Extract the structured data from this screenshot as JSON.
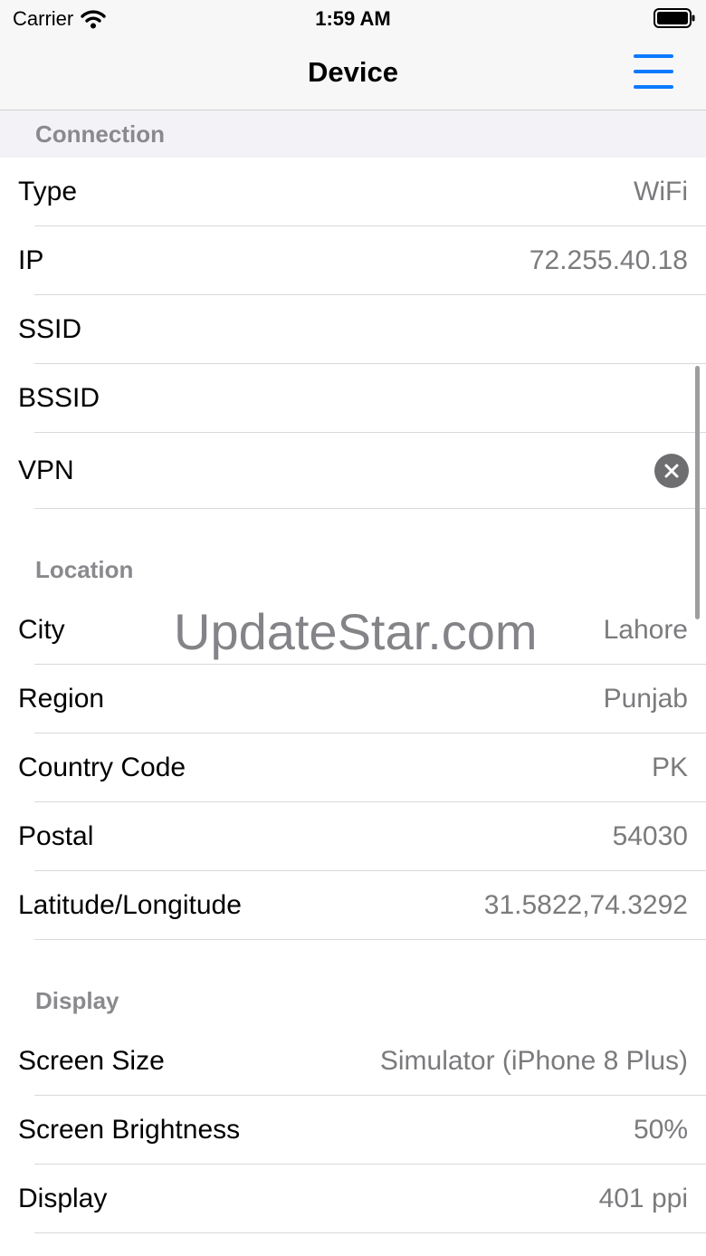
{
  "status_bar": {
    "carrier": "Carrier",
    "time": "1:59 AM",
    "wifi_icon": "wifi-icon",
    "battery_icon": "battery-icon"
  },
  "nav": {
    "title": "Device",
    "menu_icon": "hamburger-menu-icon",
    "accent_color": "#0A7AFF"
  },
  "sections": {
    "connection": {
      "header": "Connection",
      "rows": [
        {
          "label": "Type",
          "value": "WiFi"
        },
        {
          "label": "IP",
          "value": "72.255.40.18"
        },
        {
          "label": "SSID",
          "value": ""
        },
        {
          "label": "BSSID",
          "value": ""
        },
        {
          "label": "VPN",
          "icon": "close-circle-icon"
        }
      ]
    },
    "location": {
      "header": "Location",
      "rows": [
        {
          "label": "City",
          "value": "Lahore"
        },
        {
          "label": "Region",
          "value": "Punjab"
        },
        {
          "label": "Country Code",
          "value": "PK"
        },
        {
          "label": "Postal",
          "value": "54030"
        },
        {
          "label": "Latitude/Longitude",
          "value": "31.5822,74.3292"
        }
      ]
    },
    "display": {
      "header": "Display",
      "rows": [
        {
          "label": "Screen Size",
          "value": "Simulator (iPhone 8 Plus)"
        },
        {
          "label": "Screen Brightness",
          "value": "50%"
        },
        {
          "label": "Display",
          "value": "401 ppi"
        }
      ]
    }
  },
  "watermark": "UpdateStar.com"
}
